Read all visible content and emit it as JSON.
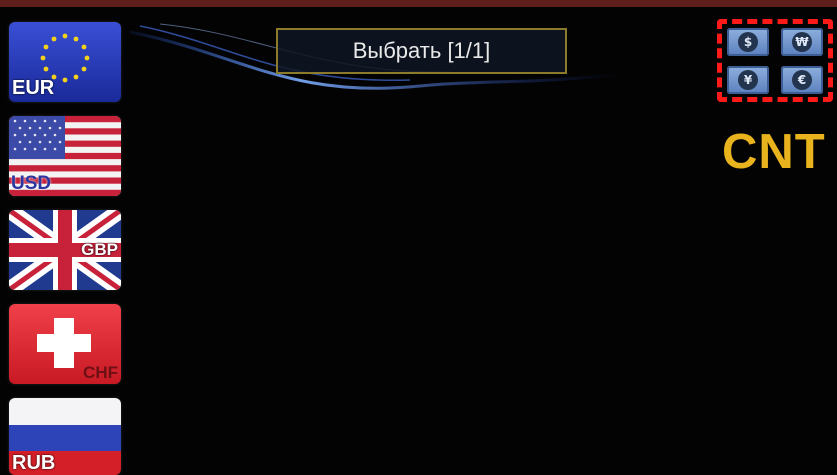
{
  "title": "Выбрать [1/1]",
  "brand": "CNT",
  "colors": {
    "background": "#030303",
    "title_border": "#8c7b2a",
    "brand": "#e8b31c",
    "mode_highlight": "#ff1a1a",
    "top_bar": "#5e1f1c"
  },
  "currencies": [
    {
      "code": "EUR",
      "icon": "eu-flag-icon"
    },
    {
      "code": "USD",
      "icon": "us-flag-icon"
    },
    {
      "code": "GBP",
      "icon": "uk-flag-icon"
    },
    {
      "code": "CHF",
      "icon": "swiss-flag-icon"
    },
    {
      "code": "RUB",
      "icon": "russia-flag-icon"
    }
  ],
  "modes": [
    {
      "symbol": "$",
      "icon": "dollar-mode-icon"
    },
    {
      "symbol": "₩",
      "icon": "won-mode-icon"
    },
    {
      "symbol": "¥",
      "icon": "yen-mode-icon"
    },
    {
      "symbol": "€",
      "icon": "euro-mode-icon"
    }
  ]
}
